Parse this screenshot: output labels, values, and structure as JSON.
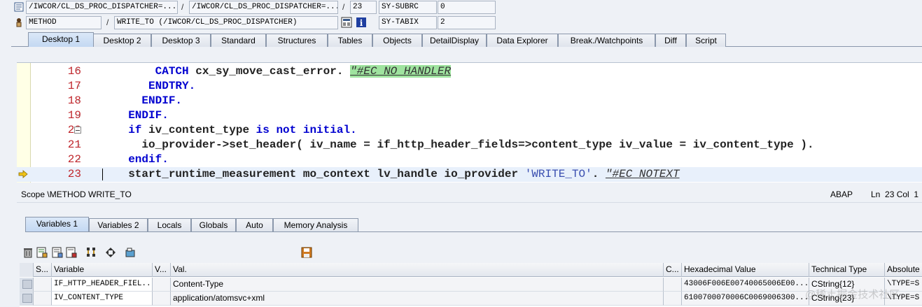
{
  "header": {
    "row1": {
      "field1": "/IWCOR/CL_DS_PROC_DISPATCHER=...",
      "field2": "/IWCOR/CL_DS_PROC_DISPATCHER=...",
      "field3": "23",
      "sysvar": "SY-SUBRC",
      "sysval": "0"
    },
    "row2": {
      "type": "METHOD",
      "name": "WRITE_TO (/IWCOR/CL_DS_PROC_DISPATCHER)",
      "sysvar": "SY-TABIX",
      "sysval": "2"
    },
    "separator": "/"
  },
  "tabs": [
    {
      "label": "Desktop 1",
      "active": true
    },
    {
      "label": "Desktop 2"
    },
    {
      "label": "Desktop 3"
    },
    {
      "label": "Standard"
    },
    {
      "label": "Structures"
    },
    {
      "label": "Tables"
    },
    {
      "label": "Objects"
    },
    {
      "label": "DetailDisplay"
    },
    {
      "label": "Data Explorer"
    },
    {
      "label": "Break./Watchpoints"
    },
    {
      "label": "Diff"
    },
    {
      "label": "Script"
    }
  ],
  "code": {
    "lines": [
      {
        "num": "16",
        "tokens": [
          [
            "kw",
            "      CATCH "
          ],
          [
            "id",
            "cx_sy_move_cast_error. "
          ],
          [
            "cmthl",
            "\"#EC NO HANDLER"
          ]
        ]
      },
      {
        "num": "17",
        "tokens": [
          [
            "kw",
            "     ENDTRY."
          ]
        ]
      },
      {
        "num": "18",
        "tokens": [
          [
            "kw",
            "    ENDIF."
          ]
        ]
      },
      {
        "num": "19",
        "tokens": [
          [
            "kw",
            "  ENDIF."
          ]
        ]
      },
      {
        "num": "20",
        "tokens": [
          [
            "kw",
            "  if "
          ],
          [
            "id",
            "iv_content_type "
          ],
          [
            "kw",
            "is not initial."
          ]
        ]
      },
      {
        "num": "21",
        "tokens": [
          [
            "id",
            "    io_provider->set_header( iv_name = if_http_header_fields=>content_type iv_value = iv_content_type )."
          ]
        ]
      },
      {
        "num": "22",
        "tokens": [
          [
            "kw",
            "  endif."
          ]
        ]
      },
      {
        "num": "23",
        "tokens": [
          [
            "id",
            "  start_runtime_measurement mo_context lv_handle io_provider "
          ],
          [
            "str",
            "'WRITE_TO'"
          ],
          [
            "id",
            ". "
          ],
          [
            "cmt",
            "\"#EC NOTEXT"
          ]
        ]
      }
    ]
  },
  "status": {
    "scope": "Scope \\METHOD WRITE_TO",
    "lang": "ABAP",
    "pos": "Ln  23 Col  1"
  },
  "tabs2": [
    {
      "label": "Variables 1",
      "active": true
    },
    {
      "label": "Variables 2"
    },
    {
      "label": "Locals"
    },
    {
      "label": "Globals"
    },
    {
      "label": "Auto"
    },
    {
      "label": "Memory Analysis"
    }
  ],
  "toolbar_icons": [
    "trash-icon",
    "edit-icon",
    "table-icon",
    "save-icon",
    "tree-icon",
    "expand-icon",
    "object-icon",
    "local-save-icon"
  ],
  "grid": {
    "headers": [
      "S...",
      "Variable",
      "V...",
      "Val.",
      "C...",
      "Hexadecimal Value",
      "Technical Type",
      "Absolute"
    ],
    "rows": [
      [
        "",
        "IF_HTTP_HEADER_FIEL...",
        "",
        "Content-Type",
        "",
        "43006F006E00740065006E00...",
        "CString{12}",
        "\\TYPE=S"
      ],
      [
        "",
        "IV_CONTENT_TYPE",
        "",
        "application/atomsvc+xml",
        "",
        "6100700070006C0069006300...",
        "CString{23}",
        "\\TYPE=S"
      ]
    ]
  },
  "watermark": "@稀土掘金技术社区"
}
